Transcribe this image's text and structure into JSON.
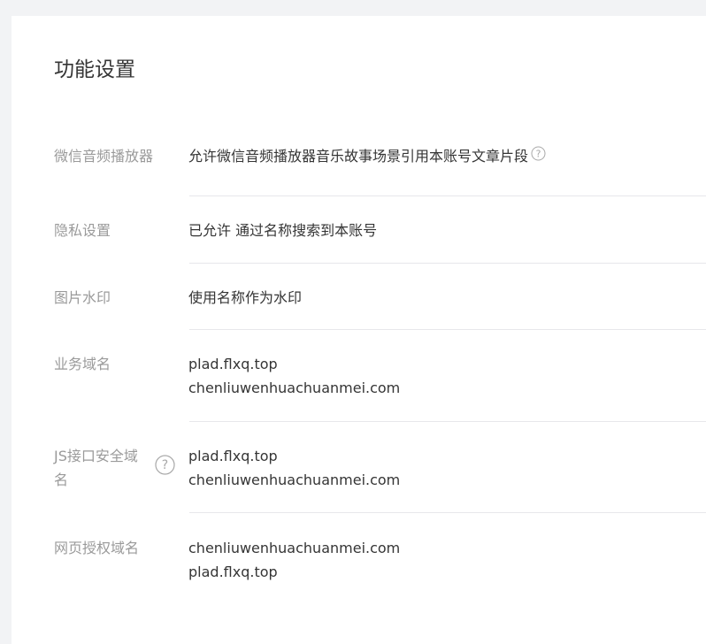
{
  "page": {
    "title": "功能设置"
  },
  "settings": [
    {
      "label": "微信音频播放器",
      "value": "允许微信音频播放器音乐故事场景引用本账号文章片段",
      "help_icon": "question-circle-icon"
    },
    {
      "label": "隐私设置",
      "value": "已允许 通过名称搜索到本账号"
    },
    {
      "label": "图片水印",
      "value": "使用名称作为水印"
    },
    {
      "label": "业务域名",
      "lines": [
        "plad.flxq.top",
        "chenliuwenhuachuanmei.com"
      ]
    },
    {
      "label": "JS接口安全域名",
      "help_icon": "question-circle-icon",
      "lines": [
        "plad.flxq.top",
        "chenliuwenhuachuanmei.com"
      ]
    },
    {
      "label": "网页授权域名",
      "lines": [
        "chenliuwenhuachuanmei.com",
        "plad.flxq.top"
      ]
    }
  ],
  "colors": {
    "background": "#f2f3f5",
    "card": "#ffffff",
    "label": "#9a9a9a",
    "value": "#353535",
    "divider": "#e7e7eb"
  }
}
